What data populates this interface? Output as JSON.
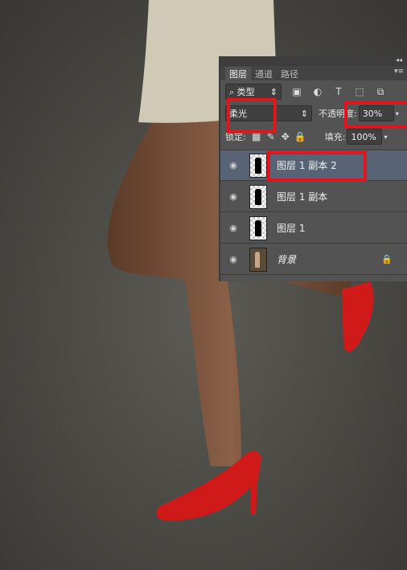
{
  "panel": {
    "collapse_icon": "double-chevron-left-icon",
    "tabs": [
      {
        "label": "图层",
        "active": true
      },
      {
        "label": "通道",
        "active": false
      },
      {
        "label": "路径",
        "active": false
      }
    ],
    "filter": {
      "label": "类型",
      "icons": [
        "image-filter-icon",
        "adjustment-filter-icon",
        "type-filter-icon",
        "shape-filter-icon",
        "smart-object-filter-icon"
      ]
    },
    "blend_mode": "柔光",
    "opacity_label": "不透明度:",
    "opacity_value": "30%",
    "lock_label": "锁定:",
    "fill_label": "填充:",
    "fill_value": "100%",
    "layers": [
      {
        "name": "图层 1 副本 2",
        "selected": true
      },
      {
        "name": "图层 1 副本",
        "selected": false
      },
      {
        "name": "图层 1",
        "selected": false
      },
      {
        "name": "背景",
        "selected": false,
        "locked": true
      }
    ],
    "highlight_color": "#e0161f",
    "selected_color": "#586476"
  }
}
